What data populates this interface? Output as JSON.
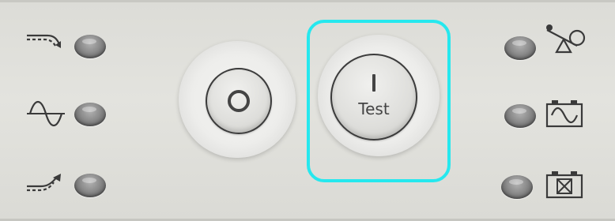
{
  "panel": {
    "left_indicators": [
      {
        "icon": "bypass-arrow-icon",
        "led": "off"
      },
      {
        "icon": "sine-wave-icon",
        "led": "off"
      },
      {
        "icon": "inverter-arrow-icon",
        "led": "off"
      }
    ],
    "right_indicators": [
      {
        "icon": "overload-seesaw-icon",
        "led": "off"
      },
      {
        "icon": "battery-ok-icon",
        "led": "off"
      },
      {
        "icon": "battery-fault-icon",
        "led": "off"
      }
    ],
    "off_button": {
      "symbol": "O"
    },
    "on_test_button": {
      "symbol": "I",
      "label": "Test"
    },
    "highlight_color": "#26e8ee"
  }
}
